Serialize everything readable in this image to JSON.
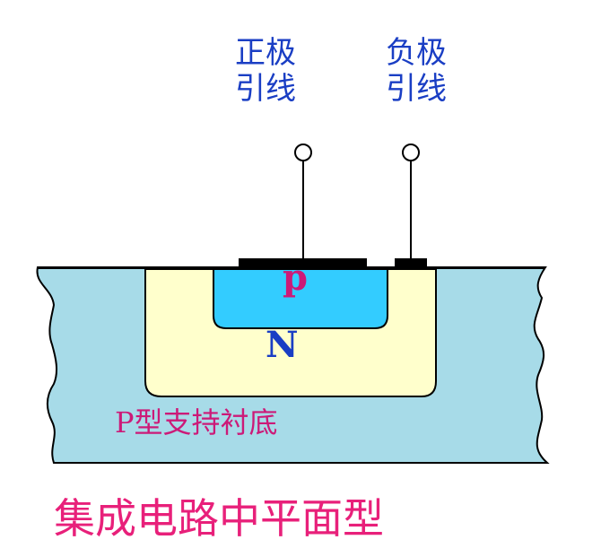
{
  "labels": {
    "positive_lead_line1": "正极",
    "positive_lead_line2": "引线",
    "negative_lead_line1": "负极",
    "negative_lead_line2": "引线",
    "p_region": "p",
    "n_region": "N",
    "substrate": "P型支持衬底",
    "caption": "集成电路中平面型"
  },
  "colors": {
    "substrate": "#a7dbe8",
    "n_region": "#ffffcc",
    "p_region": "#33ccff",
    "blue_text": "#1a3ec4",
    "magenta_text": "#cc1a78",
    "caption_text": "#e8207a",
    "electrode": "#000000"
  }
}
